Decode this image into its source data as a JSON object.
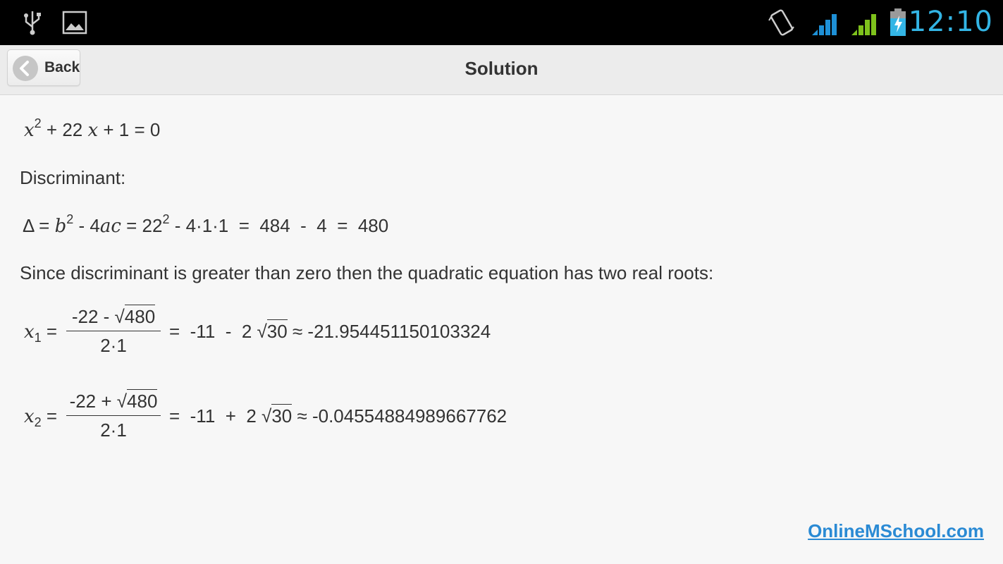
{
  "status_bar": {
    "time": "12:10",
    "icons": [
      "usb-icon",
      "image-icon",
      "vibrate-icon",
      "wifi-signal-icon",
      "cell-signal-icon",
      "battery-icon"
    ]
  },
  "header": {
    "back_label": "Back",
    "title": "Solution"
  },
  "solution": {
    "equation": {
      "term_x": "x",
      "exp": "2",
      "rest": " + 22 ",
      "term_x2": "x",
      "tail": " + 1 = 0"
    },
    "discriminant_label": "Discriminant:",
    "disc_formula": {
      "delta": "Δ = ",
      "b": "b",
      "b_exp": "2",
      "mid": " - 4",
      "ac": "ac",
      "eq": " = 22",
      "exp2": "2",
      "tail": " - 4·1·1  =  484  -  4  =  480"
    },
    "statement": "Since discriminant is greater than zero then the quadratic equation has two real roots:",
    "root1": {
      "var": "x",
      "sub": "1",
      "eq": " =",
      "num_prefix": "-22 - √",
      "num_rad": "480",
      "den": "2·1",
      "rhs_prefix": "=  -11  -  2 √",
      "rhs_rad": "30",
      "approx": " ≈ -21.954451150103324"
    },
    "root2": {
      "var": "x",
      "sub": "2",
      "eq": " =",
      "num_prefix": "-22 + √",
      "num_rad": "480",
      "den": "2·1",
      "rhs_prefix": "=  -11  +  2 √",
      "rhs_rad": "30",
      "approx": " ≈ -0.04554884989667762"
    }
  },
  "footer": {
    "link": "OnlineMSchool.com"
  },
  "colors": {
    "time": "#33b5e5",
    "link": "#2a8ad4",
    "signal_blue": "#1e90d6",
    "signal_green": "#7ec21c"
  }
}
